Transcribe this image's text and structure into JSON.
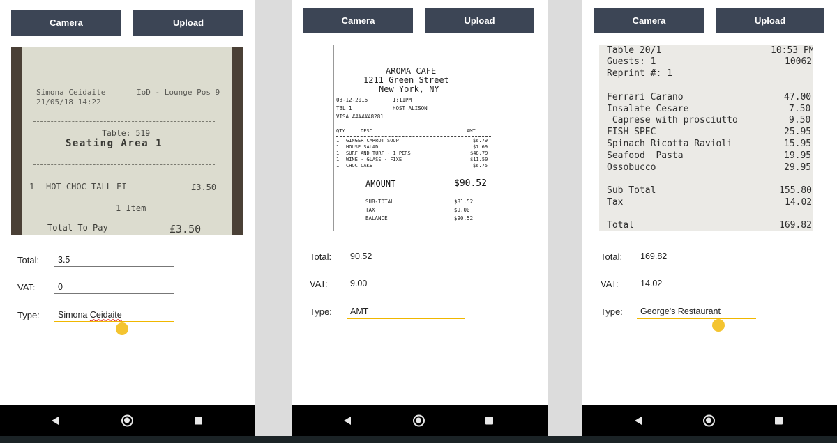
{
  "buttons": {
    "camera": "Camera",
    "upload": "Upload"
  },
  "field_labels": {
    "total": "Total:",
    "vat": "VAT:",
    "type": "Type:"
  },
  "screens": [
    {
      "receipt": {
        "server": "Simona Ceidaite",
        "datetime": "21/05/18 14:22",
        "venue": "IoD - Lounge Pos 9",
        "table": "Table: 519",
        "area": "Seating Area 1",
        "item_qty": "1",
        "item_name": "HOT CHOC TALL EI",
        "item_price": "£3.50",
        "item_count": "1 Item",
        "total_label": "Total To Pay",
        "total_value": "£3.50"
      },
      "fields": {
        "total": "3.5",
        "vat": "0",
        "type_first": "Simona",
        "type_last": "Ceidaite"
      }
    },
    {
      "receipt": {
        "name": "AROMA CAFE",
        "street": "1211 Green Street",
        "city": "New York, NY",
        "date": "03-12-2016",
        "time": "1:11PM",
        "table": "TBL 1",
        "host": "HOST ALISON",
        "visa": "VISA ######8281",
        "col_qty": "QTY",
        "col_desc": "DESC",
        "col_amt": "AMT",
        "items": [
          {
            "qty": "1",
            "desc": "GINGER CARROT SOUP",
            "amt": "$6.79"
          },
          {
            "qty": "1",
            "desc": "HOUSE SALAD",
            "amt": "$7.69"
          },
          {
            "qty": "1",
            "desc": "SURF AND TURF - 1 PERS",
            "amt": "$48.79"
          },
          {
            "qty": "1",
            "desc": "WINE - GLASS - FIXE",
            "amt": "$11.50"
          },
          {
            "qty": "1",
            "desc": "CHOC CAKE",
            "amt": "$6.75"
          }
        ],
        "amount_label": "AMOUNT",
        "amount_value": "$90.52",
        "subtotal_label": "SUB-TOTAL",
        "subtotal_value": "$81.52",
        "tax_label": "TAX",
        "tax_value": "$9.00",
        "balance_label": "BALANCE",
        "balance_value": "$90.52"
      },
      "fields": {
        "total": "90.52",
        "vat": "9.00",
        "type": "AMT"
      }
    },
    {
      "receipt": {
        "table": "Table 20/1",
        "time": "10:53 PM",
        "guests": "Guests: 1",
        "check_no": "10062",
        "reprint": "Reprint #: 1",
        "items": [
          {
            "name": "Ferrari Carano",
            "price": "47.00"
          },
          {
            "name": "Insalate Cesare",
            "price": "7.50"
          },
          {
            "name": " Caprese with prosciutto",
            "price": "9.50"
          },
          {
            "name": "FISH SPEC",
            "price": "25.95"
          },
          {
            "name": "Spinach Ricotta Ravioli",
            "price": "15.95"
          },
          {
            "name": "Seafood  Pasta",
            "price": "19.95"
          },
          {
            "name": "Ossobucco",
            "price": "29.95"
          }
        ],
        "subtotal_label": "Sub Total",
        "subtotal_value": "155.80",
        "tax_label": "Tax",
        "tax_value": "14.02",
        "total_label": "Total",
        "total_value": "169.82"
      },
      "fields": {
        "total": "169.82",
        "vat": "14.02",
        "type": "George's Restaurant"
      }
    }
  ]
}
